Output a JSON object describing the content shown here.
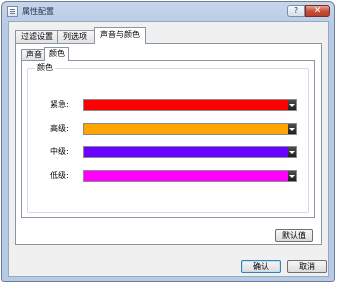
{
  "window": {
    "title": "属性配置",
    "help_label": "?",
    "close_label": "✕",
    "icon": "window-app-icon"
  },
  "tabs": [
    {
      "label": "过滤设置"
    },
    {
      "label": "列选项"
    },
    {
      "label": "声音与颜色"
    }
  ],
  "active_tab": "声音与颜色",
  "sub_tabs": [
    {
      "label": "声音"
    },
    {
      "label": "颜色"
    }
  ],
  "active_sub_tab": "颜色",
  "color_group": {
    "title": "颜色",
    "rows": [
      {
        "label": "紧急:",
        "color": "#ff0000"
      },
      {
        "label": "高级:",
        "color": "#ffa500"
      },
      {
        "label": "中级:",
        "color": "#6a00ff"
      },
      {
        "label": "低级:",
        "color": "#ff00ff"
      }
    ],
    "dropdown_icon": "chevron-down-icon"
  },
  "buttons": {
    "defaults_label": "默认值",
    "ok_label": "确认",
    "cancel_label": "取消"
  }
}
